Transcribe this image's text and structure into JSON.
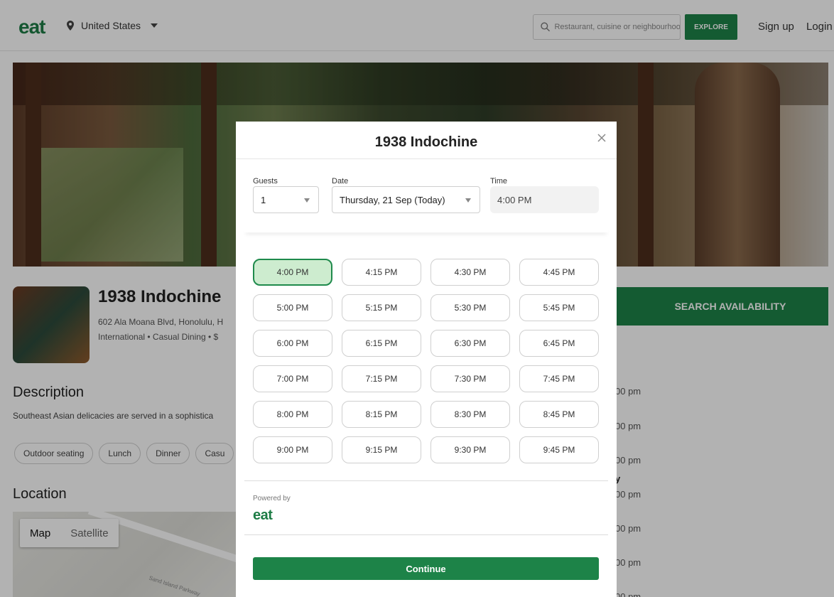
{
  "header": {
    "logo": "eat",
    "location": "United States",
    "search_placeholder": "Restaurant, cuisine or neighbourhood",
    "explore_label": "EXPLORE",
    "signup_label": "Sign up",
    "login_label": "Login"
  },
  "restaurant": {
    "name": "1938 Indochine",
    "address": "602 Ala Moana Blvd, Honolulu, H",
    "meta": "International • Casual Dining • $",
    "search_availability_label": "SEARCH AVAILABILITY",
    "description_heading": "Description",
    "description_text": "Southeast Asian delicacies are served in a sophistica",
    "tags": [
      "Outdoor seating",
      "Lunch",
      "Dinner",
      "Casu"
    ],
    "location_heading": "Location",
    "map_tabs": [
      "Map",
      "Satellite"
    ],
    "map_road_label": "Sand Island Parkway",
    "hours_fragments": [
      "00 pm",
      "00 pm",
      "00 pm",
      "y",
      "00 pm",
      "00 pm",
      "00 pm",
      "00 pm"
    ]
  },
  "modal": {
    "title": "1938 Indochine",
    "guests_label": "Guests",
    "guests_value": "1",
    "date_label": "Date",
    "date_value": "Thursday, 21 Sep (Today)",
    "time_label": "Time",
    "time_value": "4:00 PM",
    "selected_slot": "4:00 PM",
    "slots": [
      "4:00 PM",
      "4:15 PM",
      "4:30 PM",
      "4:45 PM",
      "5:00 PM",
      "5:15 PM",
      "5:30 PM",
      "5:45 PM",
      "6:00 PM",
      "6:15 PM",
      "6:30 PM",
      "6:45 PM",
      "7:00 PM",
      "7:15 PM",
      "7:30 PM",
      "7:45 PM",
      "8:00 PM",
      "8:15 PM",
      "8:30 PM",
      "8:45 PM",
      "9:00 PM",
      "9:15 PM",
      "9:30 PM",
      "9:45 PM"
    ],
    "powered_by": "Powered by",
    "powered_logo": "eat",
    "continue_label": "Continue"
  },
  "colors": {
    "brand_green": "#1d8348",
    "selected_slot_bg": "#cdeccf",
    "selected_slot_border": "#1f8a4c"
  }
}
